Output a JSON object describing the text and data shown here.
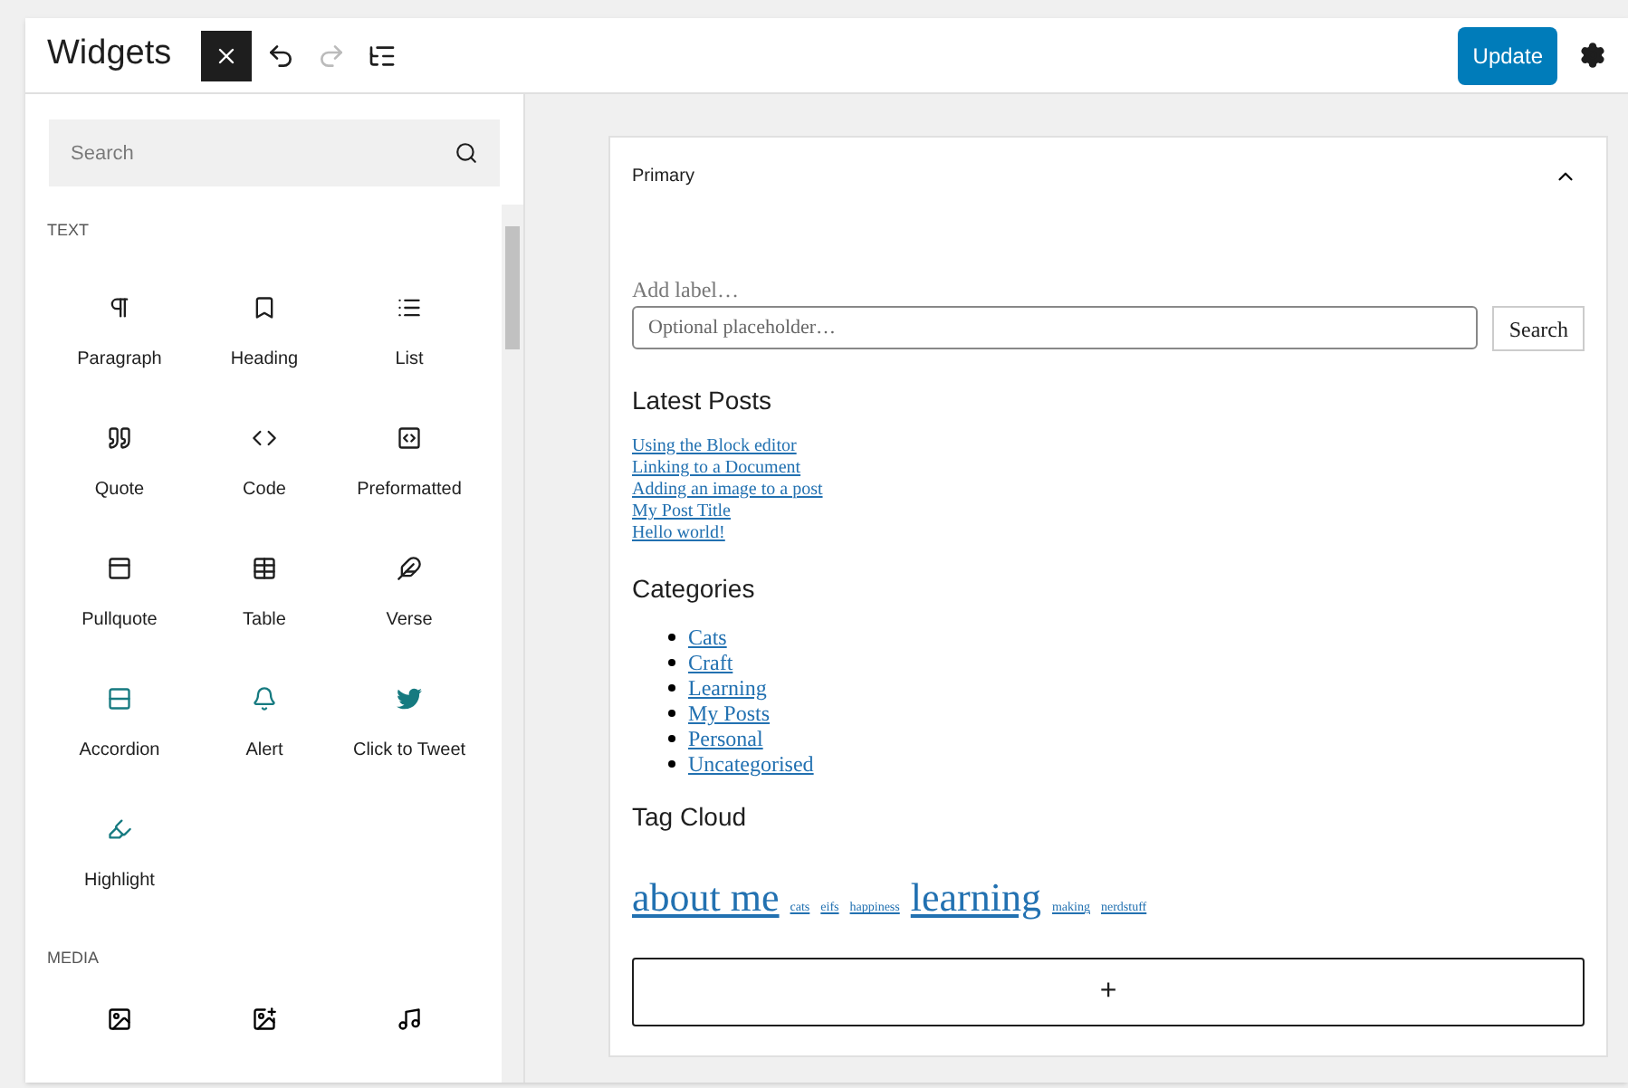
{
  "header": {
    "title": "Widgets",
    "update_button": "Update"
  },
  "sidebar": {
    "search": {
      "placeholder": "Search"
    },
    "sections": [
      {
        "heading": "TEXT",
        "blocks": [
          {
            "label": "Paragraph",
            "color": "#1e1e1e"
          },
          {
            "label": "Heading",
            "color": "#1e1e1e"
          },
          {
            "label": "List",
            "color": "#1e1e1e"
          },
          {
            "label": "Quote",
            "color": "#1e1e1e"
          },
          {
            "label": "Code",
            "color": "#1e1e1e"
          },
          {
            "label": "Preformatted",
            "color": "#1e1e1e"
          },
          {
            "label": "Pullquote",
            "color": "#1e1e1e"
          },
          {
            "label": "Table",
            "color": "#1e1e1e"
          },
          {
            "label": "Verse",
            "color": "#1e1e1e"
          },
          {
            "label": "Accordion",
            "color": "#167a80"
          },
          {
            "label": "Alert",
            "color": "#167a80"
          },
          {
            "label": "Click to Tweet",
            "color": "#167a80"
          },
          {
            "label": "Highlight",
            "color": "#167a80"
          }
        ]
      },
      {
        "heading": "MEDIA"
      }
    ]
  },
  "widget_area": {
    "title": "Primary",
    "expanded": true,
    "search_widget": {
      "label_placeholder": "Add label…",
      "input_placeholder": "Optional placeholder…",
      "button": "Search"
    },
    "latest_posts": {
      "heading": "Latest Posts",
      "links": [
        "Using the Block editor",
        "Linking to a Document",
        "Adding an image to a post",
        "My Post Title",
        "Hello world!"
      ]
    },
    "categories": {
      "heading": "Categories",
      "links": [
        "Cats",
        "Craft",
        "Learning",
        "My Posts",
        "Personal",
        "Uncategorised"
      ]
    },
    "tag_cloud": {
      "heading": "Tag Cloud",
      "tags": [
        {
          "label": "about me",
          "kind": "large"
        },
        {
          "label": "cats",
          "kind": "small"
        },
        {
          "label": "eifs",
          "kind": "small"
        },
        {
          "label": "happiness",
          "kind": "small"
        },
        {
          "label": "learning",
          "kind": "large"
        },
        {
          "label": "making",
          "kind": "small"
        },
        {
          "label": "nerdstuff",
          "kind": "small"
        }
      ]
    },
    "add_block_button": "+"
  }
}
